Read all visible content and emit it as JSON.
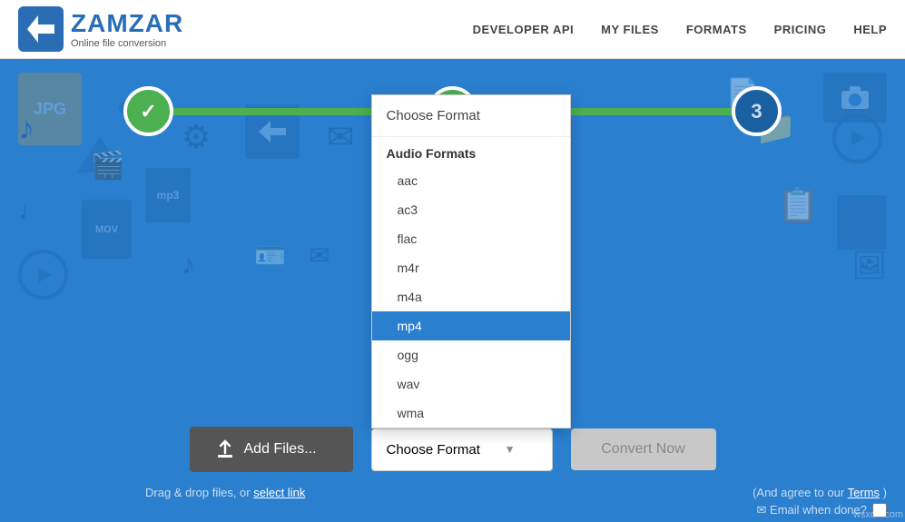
{
  "header": {
    "logo_name": "ZAMZAR",
    "logo_tagline": "Online file conversion",
    "nav": [
      {
        "label": "DEVELOPER API",
        "id": "developer-api"
      },
      {
        "label": "MY FILES",
        "id": "my-files"
      },
      {
        "label": "FORMATS",
        "id": "formats"
      },
      {
        "label": "PRICING",
        "id": "pricing"
      },
      {
        "label": "HELP",
        "id": "help"
      }
    ]
  },
  "steps": [
    {
      "number": "✓",
      "state": "done"
    },
    {
      "number": "✓",
      "state": "done"
    },
    {
      "number": "3",
      "state": "pending"
    }
  ],
  "controls": {
    "add_files_label": "Add Files...",
    "format_placeholder": "Choose Format",
    "convert_label": "Convert Now"
  },
  "dropdown": {
    "title": "Choose Format",
    "sections": [
      {
        "header": "Audio Formats",
        "items": [
          {
            "label": "aac",
            "selected": false
          },
          {
            "label": "ac3",
            "selected": false
          },
          {
            "label": "flac",
            "selected": false
          },
          {
            "label": "m4r",
            "selected": false
          },
          {
            "label": "m4a",
            "selected": false
          },
          {
            "label": "mp4",
            "selected": true
          },
          {
            "label": "ogg",
            "selected": false
          },
          {
            "label": "wav",
            "selected": false
          },
          {
            "label": "wma",
            "selected": false
          }
        ]
      }
    ]
  },
  "bottom": {
    "drag_text": "Drag & drop files, or",
    "select_link": "select link",
    "agree_text": "(And agree to our",
    "terms": "Terms",
    "agree_close": ")",
    "email_label": "✉ Email when done?"
  },
  "watermark": "wsxdn.com"
}
